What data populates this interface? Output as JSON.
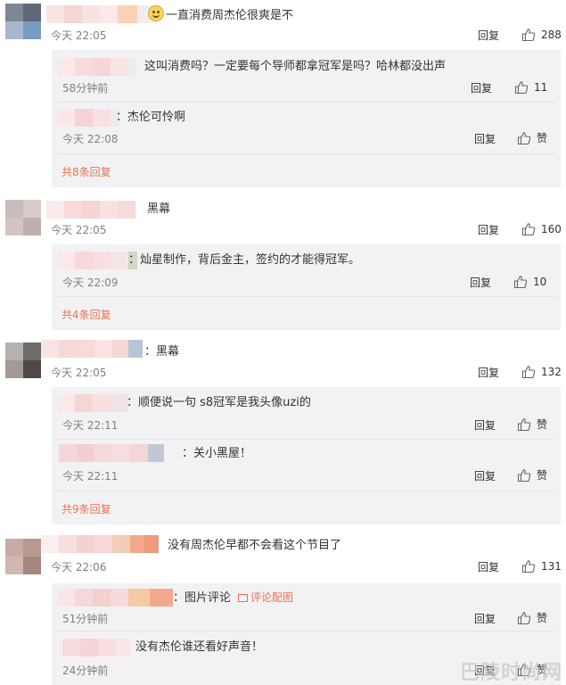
{
  "comments": [
    {
      "text": "一直消费周杰伦很爽是不",
      "emoji": "smile-emoji",
      "time": "今天 22:05",
      "reply_label": "回复",
      "likes": "288",
      "replies": [
        {
          "text": "这叫消费吗？一定要每个导师都拿冠军是吗？哈林都没出声",
          "time": "58分钟前",
          "reply_label": "回复",
          "likes": "11"
        },
        {
          "text": "：杰伦可怜啊",
          "time": "今天 22:08",
          "reply_label": "回复",
          "likes": "赞"
        }
      ],
      "more": "共8条回复"
    },
    {
      "text": "黑幕",
      "time": "今天 22:05",
      "reply_label": "回复",
      "likes": "160",
      "replies": [
        {
          "text": "：灿星制作，背后金主，签约的才能得冠军。",
          "time": "今天 22:09",
          "reply_label": "回复",
          "likes": "10"
        }
      ],
      "more": "共4条回复"
    },
    {
      "text": "：黑幕",
      "time": "今天 22:05",
      "reply_label": "回复",
      "likes": "132",
      "replies": [
        {
          "text": "：顺便说一句 s8冠军是我头像uzi的",
          "time": "今天 22:11",
          "reply_label": "回复",
          "likes": "赞"
        },
        {
          "text": "：关小黑屋！",
          "time": "今天 22:11",
          "reply_label": "回复",
          "likes": "赞"
        }
      ],
      "more": "共9条回复"
    },
    {
      "text": "没有周杰伦早都不会看这个节目了",
      "time": "今天 22:06",
      "reply_label": "回复",
      "likes": "131",
      "replies": [
        {
          "text": "：图片评论",
          "pic_link": "评论配图",
          "time": "51分钟前",
          "reply_label": "回复",
          "likes": "赞"
        },
        {
          "text": "没有杰伦谁还看好声音！",
          "time": "24分钟前",
          "reply_label": "回复",
          "likes": "赞"
        }
      ]
    }
  ],
  "watermark": "巴陵时尚网",
  "colors": {
    "accent": "#eb7350",
    "reply_bg": "#f2f2f5",
    "meta": "#808080"
  }
}
